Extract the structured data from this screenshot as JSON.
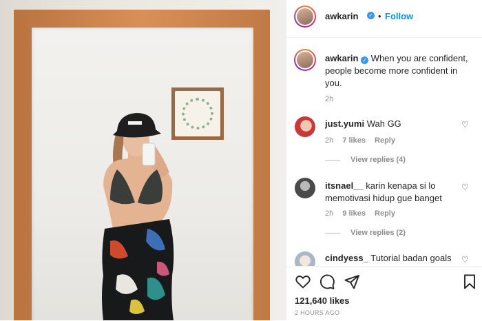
{
  "header": {
    "username": "awkarin",
    "separator": "•",
    "follow_label": "Follow"
  },
  "caption": {
    "username": "awkarin",
    "text": "When you are confident, people become more confident in you.",
    "time": "2h"
  },
  "comments": [
    {
      "username": "just.yumi",
      "text": "Wah GG",
      "time": "2h",
      "likes": "7 likes",
      "reply_label": "Reply",
      "view_replies": "View replies (4)"
    },
    {
      "username": "itsnael__",
      "text": "karin kenapa si lo memotivasi hidup gue banget",
      "time": "2h",
      "likes": "9 likes",
      "reply_label": "Reply",
      "view_replies": "View replies (2)"
    },
    {
      "username": "cindyess_",
      "text": "Tutorial badan goals"
    }
  ],
  "actions": {
    "like_icon": "heart-icon",
    "comment_icon": "comment-icon",
    "share_icon": "share-icon",
    "save_icon": "bookmark-icon"
  },
  "likes_count": "121,640 likes",
  "post_time": "2 HOURS AGO",
  "colors": {
    "link_blue": "#0095f6",
    "verified_blue": "#3897f0",
    "secondary_text": "#8e8e8e",
    "primary_text": "#262626",
    "frame_wood": "#c98348"
  }
}
